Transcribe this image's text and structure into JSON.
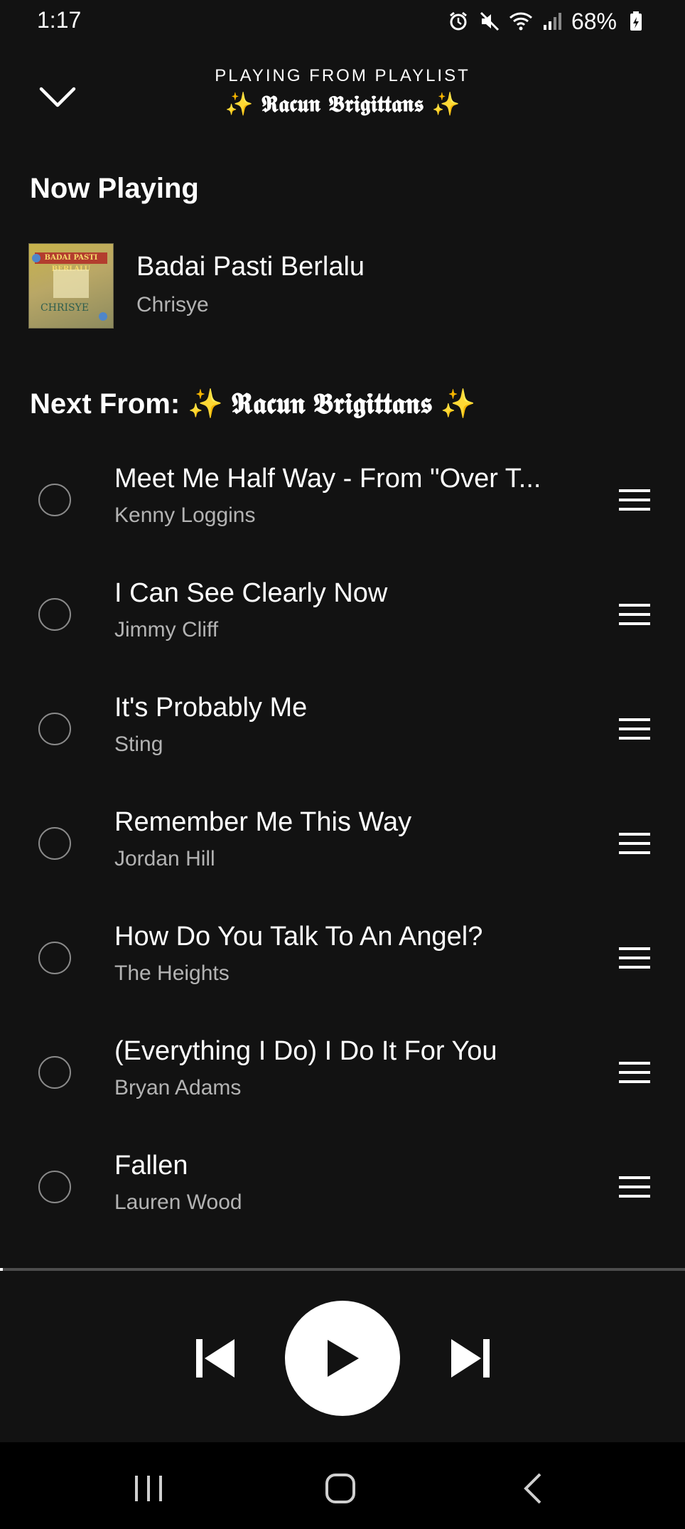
{
  "status_bar": {
    "time": "1:17",
    "battery": "68%",
    "icons": [
      "alarm-icon",
      "mute-icon",
      "wifi-icon",
      "signal-icon",
      "battery-icon"
    ]
  },
  "header": {
    "context_label": "PLAYING FROM PLAYLIST",
    "playlist_name": "✨ 𝕽𝖆𝖈𝖚𝖓 𝕭𝖗𝖎𝖌𝖎𝖙𝖙𝖆𝖓𝖘 ✨"
  },
  "now_playing": {
    "section_title": "Now Playing",
    "title": "Badai Pasti Berlalu",
    "artist": "Chrisye",
    "album_art_text": "BADAI PASTI BERLALU",
    "album_art_artist": "CHRISYE"
  },
  "next_from": {
    "section_title": "Next From: ✨ 𝕽𝖆𝖈𝖚𝖓 𝕭𝖗𝖎𝖌𝖎𝖙𝖙𝖆𝖓𝖘 ✨"
  },
  "queue": [
    {
      "title": "Meet Me Half Way - From \"Over T...",
      "artist": "Kenny Loggins"
    },
    {
      "title": "I Can See Clearly Now",
      "artist": "Jimmy Cliff"
    },
    {
      "title": "It's Probably Me",
      "artist": "Sting"
    },
    {
      "title": "Remember Me This Way",
      "artist": "Jordan Hill"
    },
    {
      "title": "How Do You Talk To An Angel?",
      "artist": "The Heights"
    },
    {
      "title": "(Everything I Do) I Do It For You",
      "artist": "Bryan Adams"
    },
    {
      "title": "Fallen",
      "artist": "Lauren Wood"
    }
  ],
  "player": {
    "progress_fraction": 0.003
  },
  "colors": {
    "background": "#121212",
    "text_primary": "#ffffff",
    "text_secondary": "#b3b3b3",
    "nav_bar": "#000000"
  }
}
